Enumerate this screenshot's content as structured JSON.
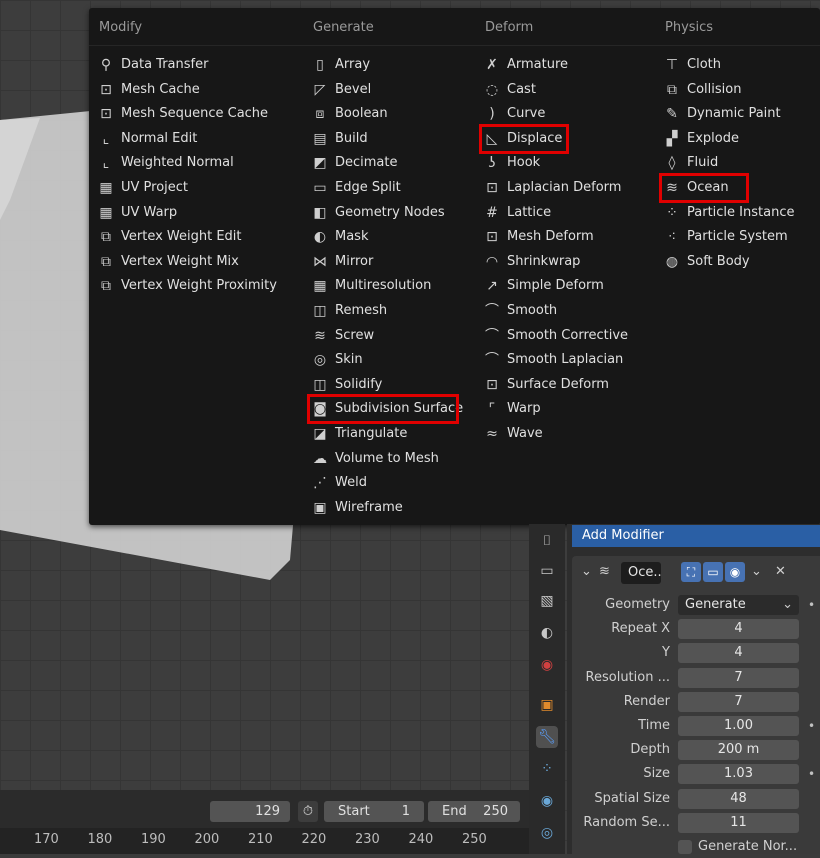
{
  "menu": {
    "columns": [
      {
        "heading": "Modify",
        "items": [
          {
            "label": "Data Transfer",
            "icon": "data-transfer-icon",
            "glyph": "⚲"
          },
          {
            "label": "Mesh Cache",
            "icon": "mesh-cache-icon",
            "glyph": "⊡"
          },
          {
            "label": "Mesh Sequence Cache",
            "icon": "mesh-sequence-cache-icon",
            "glyph": "⊡"
          },
          {
            "label": "Normal Edit",
            "icon": "normal-edit-icon",
            "glyph": "⌞"
          },
          {
            "label": "Weighted Normal",
            "icon": "weighted-normal-icon",
            "glyph": "⌞"
          },
          {
            "label": "UV Project",
            "icon": "uv-project-icon",
            "glyph": "▦"
          },
          {
            "label": "UV Warp",
            "icon": "uv-warp-icon",
            "glyph": "▦"
          },
          {
            "label": "Vertex Weight Edit",
            "icon": "vertex-weight-edit-icon",
            "glyph": "⧉"
          },
          {
            "label": "Vertex Weight Mix",
            "icon": "vertex-weight-mix-icon",
            "glyph": "⧉"
          },
          {
            "label": "Vertex Weight Proximity",
            "icon": "vertex-weight-proximity-icon",
            "glyph": "⧉"
          }
        ]
      },
      {
        "heading": "Generate",
        "items": [
          {
            "label": "Array",
            "icon": "array-icon",
            "glyph": "▯"
          },
          {
            "label": "Bevel",
            "icon": "bevel-icon",
            "glyph": "◸"
          },
          {
            "label": "Boolean",
            "icon": "boolean-icon",
            "glyph": "⧈"
          },
          {
            "label": "Build",
            "icon": "build-icon",
            "glyph": "▤"
          },
          {
            "label": "Decimate",
            "icon": "decimate-icon",
            "glyph": "◩"
          },
          {
            "label": "Edge Split",
            "icon": "edge-split-icon",
            "glyph": "▭"
          },
          {
            "label": "Geometry Nodes",
            "icon": "geometry-nodes-icon",
            "glyph": "◧"
          },
          {
            "label": "Mask",
            "icon": "mask-icon",
            "glyph": "◐"
          },
          {
            "label": "Mirror",
            "icon": "mirror-icon",
            "glyph": "⋈"
          },
          {
            "label": "Multiresolution",
            "icon": "multiresolution-icon",
            "glyph": "▦"
          },
          {
            "label": "Remesh",
            "icon": "remesh-icon",
            "glyph": "◫"
          },
          {
            "label": "Screw",
            "icon": "screw-icon",
            "glyph": "≋"
          },
          {
            "label": "Skin",
            "icon": "skin-icon",
            "glyph": "◎"
          },
          {
            "label": "Solidify",
            "icon": "solidify-icon",
            "glyph": "◫"
          },
          {
            "label": "Subdivision Surface",
            "icon": "subdivision-surface-icon",
            "glyph": "◙"
          },
          {
            "label": "Triangulate",
            "icon": "triangulate-icon",
            "glyph": "◪"
          },
          {
            "label": "Volume to Mesh",
            "icon": "volume-to-mesh-icon",
            "glyph": "☁"
          },
          {
            "label": "Weld",
            "icon": "weld-icon",
            "glyph": "⋰"
          },
          {
            "label": "Wireframe",
            "icon": "wireframe-icon",
            "glyph": "▣"
          }
        ]
      },
      {
        "heading": "Deform",
        "items": [
          {
            "label": "Armature",
            "icon": "armature-icon",
            "glyph": "✗"
          },
          {
            "label": "Cast",
            "icon": "cast-icon",
            "glyph": "◌"
          },
          {
            "label": "Curve",
            "icon": "curve-icon",
            "glyph": ")"
          },
          {
            "label": "Displace",
            "icon": "displace-icon",
            "glyph": "◺"
          },
          {
            "label": "Hook",
            "icon": "hook-icon",
            "glyph": "ʖ"
          },
          {
            "label": "Laplacian Deform",
            "icon": "laplacian-deform-icon",
            "glyph": "⊡"
          },
          {
            "label": "Lattice",
            "icon": "lattice-icon",
            "glyph": "#"
          },
          {
            "label": "Mesh Deform",
            "icon": "mesh-deform-icon",
            "glyph": "⊡"
          },
          {
            "label": "Shrinkwrap",
            "icon": "shrinkwrap-icon",
            "glyph": "◠"
          },
          {
            "label": "Simple Deform",
            "icon": "simple-deform-icon",
            "glyph": "↗"
          },
          {
            "label": "Smooth",
            "icon": "smooth-icon",
            "glyph": "⌒"
          },
          {
            "label": "Smooth Corrective",
            "icon": "smooth-corrective-icon",
            "glyph": "⌒"
          },
          {
            "label": "Smooth Laplacian",
            "icon": "smooth-laplacian-icon",
            "glyph": "⌒"
          },
          {
            "label": "Surface Deform",
            "icon": "surface-deform-icon",
            "glyph": "⊡"
          },
          {
            "label": "Warp",
            "icon": "warp-icon",
            "glyph": "⌜"
          },
          {
            "label": "Wave",
            "icon": "wave-icon",
            "glyph": "≈"
          }
        ]
      },
      {
        "heading": "Physics",
        "items": [
          {
            "label": "Cloth",
            "icon": "cloth-icon",
            "glyph": "⊤"
          },
          {
            "label": "Collision",
            "icon": "collision-icon",
            "glyph": "⧉"
          },
          {
            "label": "Dynamic Paint",
            "icon": "dynamic-paint-icon",
            "glyph": "✎"
          },
          {
            "label": "Explode",
            "icon": "explode-icon",
            "glyph": "▞"
          },
          {
            "label": "Fluid",
            "icon": "fluid-icon",
            "glyph": "◊"
          },
          {
            "label": "Ocean",
            "icon": "ocean-icon",
            "glyph": "≋"
          },
          {
            "label": "Particle Instance",
            "icon": "particle-instance-icon",
            "glyph": "⁘"
          },
          {
            "label": "Particle System",
            "icon": "particle-system-icon",
            "glyph": "⁖"
          },
          {
            "label": "Soft Body",
            "icon": "soft-body-icon",
            "glyph": "◍"
          }
        ]
      }
    ]
  },
  "panel": {
    "header": "Add Modifier",
    "modifier_name": "Oce...",
    "rows": [
      {
        "label": "Geometry",
        "value": "Generate",
        "type": "select",
        "dot": true
      },
      {
        "label": "Repeat X",
        "value": "4"
      },
      {
        "label": "Y",
        "value": "4"
      },
      {
        "label": "Resolution ...",
        "value": "7"
      },
      {
        "label": "Render",
        "value": "7"
      },
      {
        "label": "Time",
        "value": "1.00",
        "dot": true
      },
      {
        "label": "Depth",
        "value": "200 m"
      },
      {
        "label": "Size",
        "value": "1.03",
        "dot": true
      },
      {
        "label": "Spatial Size",
        "value": "48"
      },
      {
        "label": "Random Se...",
        "value": "11"
      }
    ],
    "checkbox_label": "Generate Nor..."
  },
  "timeline": {
    "current_frame": "129",
    "start_label": "Start",
    "start_value": "1",
    "end_label": "End",
    "end_value": "250",
    "ticks": [
      "170",
      "180",
      "190",
      "200",
      "210",
      "220",
      "230",
      "240",
      "250"
    ]
  },
  "colors": {
    "highlight": "#e00000",
    "menu_bg": "#171717",
    "accent": "#4772b3"
  }
}
